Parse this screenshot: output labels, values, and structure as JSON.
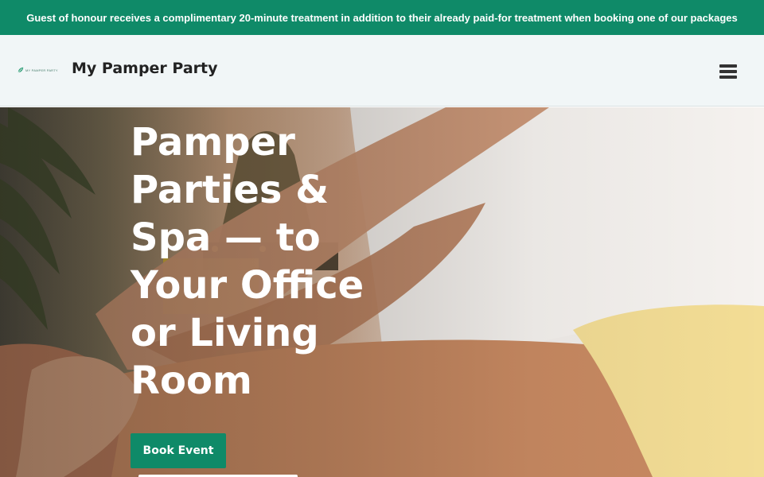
{
  "announcement": {
    "text": "Guest of honour receives a complimentary 20-minute treatment in addition to their already paid-for treatment when booking one of our packages"
  },
  "header": {
    "logo_text": "MY PAMPER PARTY",
    "site_title": "My Pamper Party",
    "menu_icon": "hamburger-menu-icon"
  },
  "hero": {
    "heading_lines": [
      "Pamper",
      "Parties &",
      "Spa — to",
      "Your Office",
      "or Living",
      "Room"
    ],
    "book_button": "Book Event"
  },
  "colors": {
    "accent": "#0f8a68",
    "header_bg": "#f1f6f7",
    "title_text": "#222222",
    "hero_text": "#ffffff"
  }
}
